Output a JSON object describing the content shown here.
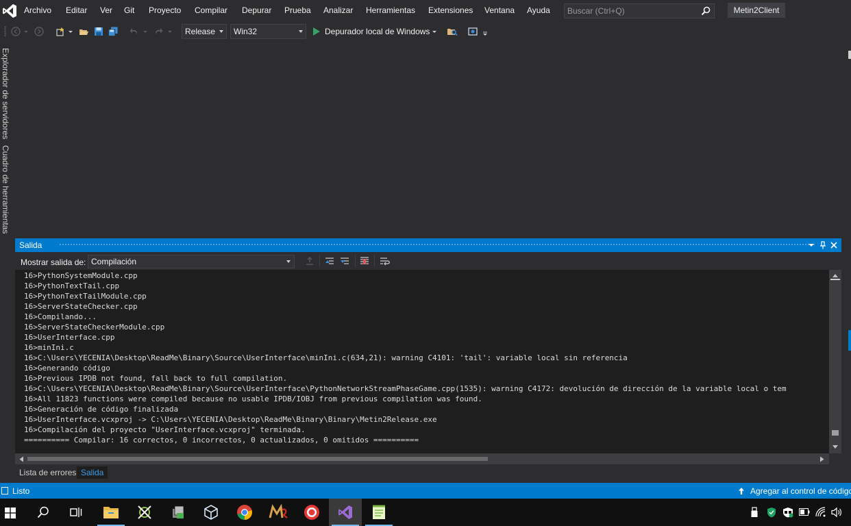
{
  "menu": {
    "items": [
      "Archivo",
      "Editar",
      "Ver",
      "Git",
      "Proyecto",
      "Compilar",
      "Depurar",
      "Prueba",
      "Analizar",
      "Herramientas",
      "Extensiones",
      "Ventana",
      "Ayuda"
    ],
    "search_placeholder": "Buscar (Ctrl+Q)",
    "solution_name": "Metin2Client"
  },
  "toolbar": {
    "configuration": "Release",
    "platform": "Win32",
    "debugger_label": "Depurador local de Windows"
  },
  "side_tabs": {
    "server_explorer": "Explorador de servidores",
    "toolbox": "Cuadro de herramientas"
  },
  "output": {
    "title": "Salida",
    "show_from_label": "Mostrar salida de:",
    "source": "Compilación",
    "lines": [
      "16>PythonSystemModule.cpp",
      "16>PythonTextTail.cpp",
      "16>PythonTextTailModule.cpp",
      "16>ServerStateChecker.cpp",
      "16>Compilando...",
      "16>ServerStateCheckerModule.cpp",
      "16>UserInterface.cpp",
      "16>minIni.c",
      "16>C:\\Users\\YECENIA\\Desktop\\ReadMe\\Binary\\Source\\UserInterface\\minIni.c(634,21): warning C4101: 'tail': variable local sin referencia",
      "16>Generando código",
      "16>Previous IPDB not found, fall back to full compilation.",
      "16>C:\\Users\\YECENIA\\Desktop\\ReadMe\\Binary\\Source\\UserInterface\\PythonNetworkStreamPhaseGame.cpp(1535): warning C4172: devolución de dirección de la variable local o tem",
      "16>All 11823 functions were compiled because no usable IPDB/IOBJ from previous compilation was found.",
      "16>Generación de código finalizada",
      "16>UserInterface.vcxproj -> C:\\Users\\YECENIA\\Desktop\\ReadMe\\Binary\\Binary\\Metin2Release.exe",
      "16>Compilación del proyecto \"UserInterface.vcxproj\" terminada.",
      "========== Compilar: 16 correctos, 0 incorrectos, 0 actualizados, 0 omitidos =========="
    ]
  },
  "bottom_tabs": {
    "error_list": "Lista de errores",
    "output": "Salida"
  },
  "status": {
    "text": "Listo",
    "source_control": "Agregar al control de código"
  },
  "colors": {
    "accent": "#007acc",
    "background": "#2d2d30",
    "editor": "#1e1e1e",
    "play": "#38a169"
  }
}
